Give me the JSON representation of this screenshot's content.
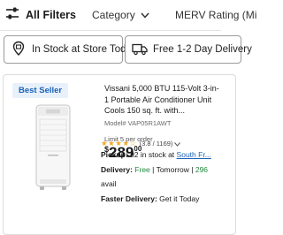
{
  "filters": {
    "all_filters_label": "All Filters",
    "category_label": "Category",
    "merv_label": "MERV Rating (Mi"
  },
  "toggles": {
    "in_stock_label": "In Stock at Store Today",
    "delivery_label": "Free 1-2 Day Delivery"
  },
  "product": {
    "badge": "Best Seller",
    "title_line1": "Vissani 5,000 BTU 115-Volt 3-in-",
    "title_line2": "1 Portable Air Conditioner Unit",
    "title_line3": "Cools 150 sq. ft. with...",
    "model": "Model# VAP05R1AWT",
    "limit": "Limit 5 per order",
    "price_currency": "$",
    "price_dollars": "289",
    "price_cents": "00",
    "rating_value": 3.8,
    "stars": "★★★★☆",
    "rating_text": "(3.8 / 1169)",
    "pickup_label": "Pickup:",
    "pickup_text": "92 in stock at",
    "pickup_store": "South Fr...",
    "delivery_label": "Delivery:",
    "delivery_free": "Free",
    "delivery_sep": "| Tomorrow |",
    "delivery_count": "296",
    "delivery_avail": "avail",
    "faster_label": "Faster Delivery:",
    "faster_text": "Get it Today"
  },
  "colors": {
    "badge_bg": "#e8f1fb",
    "badge_text": "#1a62b8",
    "star": "#f5a623",
    "in_stock_green": "#1f8a3b"
  }
}
